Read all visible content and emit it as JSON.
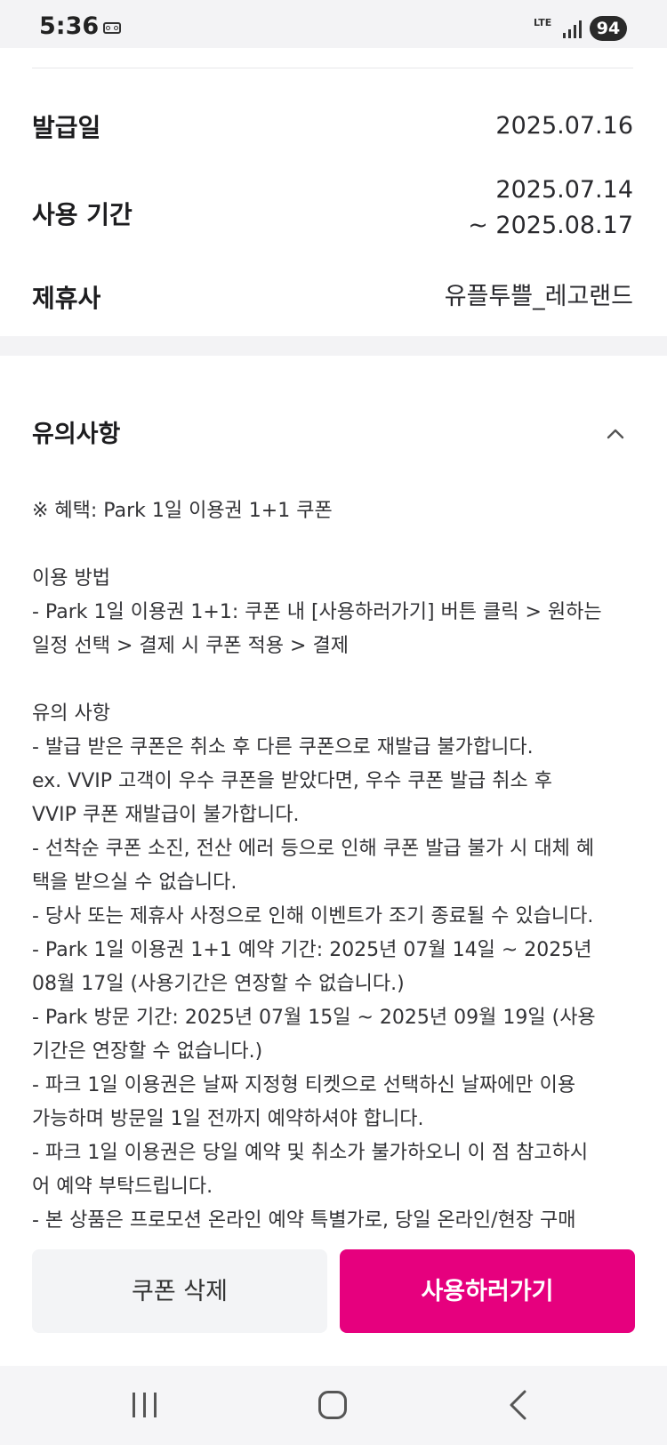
{
  "status_bar": {
    "time": "5:36",
    "network": "LTE",
    "battery": "94"
  },
  "coupon_info": {
    "issue_date_label": "발급일",
    "issue_date_value": "2025.07.16",
    "period_label": "사용 기간",
    "period_start": "2025.07.14",
    "period_end": "~ 2025.08.17",
    "partner_label": "제휴사",
    "partner_value": "유플투쁠_레고랜드"
  },
  "notice": {
    "title": "유의사항",
    "lines": [
      "※ 혜택: Park 1일 이용권 1+1 쿠폰",
      "",
      "이용 방법",
      "- Park 1일 이용권 1+1: 쿠폰 내 [사용하러가기] 버튼 클릭 > 원하는",
      "일정 선택 > 결제 시 쿠폰 적용 > 결제",
      "",
      "유의 사항",
      "- 발급 받은 쿠폰은 취소 후 다른 쿠폰으로 재발급 불가합니다.",
      "ex. VVIP 고객이 우수 쿠폰을 받았다면, 우수 쿠폰 발급 취소 후",
      "VVIP 쿠폰 재발급이 불가합니다.",
      "- 선착순 쿠폰 소진, 전산 에러 등으로 인해 쿠폰 발급 불가 시 대체 혜",
      "택을 받으실 수 없습니다.",
      "- 당사 또는 제휴사 사정으로 인해 이벤트가 조기 종료될 수 있습니다.",
      "- Park 1일 이용권 1+1 예약 기간: 2025년 07월 14일 ~ 2025년",
      "08월 17일 (사용기간은 연장할 수 없습니다.)",
      "- Park 방문 기간: 2025년 07월 15일 ~ 2025년 09월 19일 (사용",
      "기간은 연장할 수 없습니다.)",
      "- 파크 1일 이용권은 날짜 지정형 티켓으로 선택하신 날짜에만 이용",
      "가능하며 방문일 1일 전까지 예약하셔야 합니다.",
      "- 파크 1일 이용권은 당일 예약 및 취소가 불가하오니 이 점 참고하시",
      "어 예약 부탁드립니다.",
      "- 본 상품은 프로모션 온라인 예약 특별가로, 당일 온라인/현장 구매"
    ]
  },
  "buttons": {
    "delete_label": "쿠폰 삭제",
    "use_label": "사용하러가기"
  },
  "colors": {
    "accent": "#e6007e",
    "secondary_button": "#f3f4f6"
  }
}
